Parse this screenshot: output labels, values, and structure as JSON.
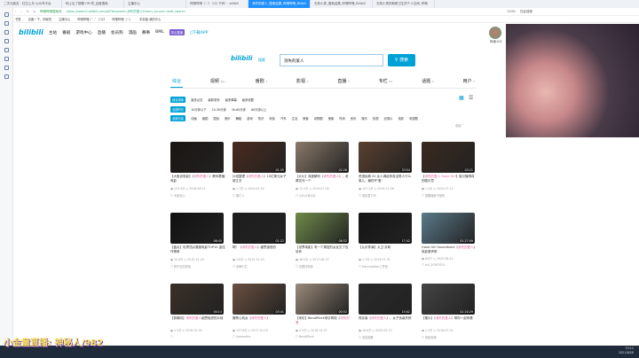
{
  "browser": {
    "tabs": [
      "二次元朋友 · 红白上月 公众号平台",
      "网上出了部跟 OR 吧_百度搜索",
      "主播中心",
      "哔哩哔哩（'-'）つロ 干杯~ -bilibili",
      "消失的爱人_搜索结果_哔哩哔哩_Bilibili",
      "无效小男_搜索结果_哔哩哔哩_Bilibili",
      "无效小男的和鲜卫生的个人空间_哔哩"
    ],
    "url_label": "哔哩哔哩搜索页",
    "url": "https://search.bilibili.com/all?keyword=消失的爱人&from_source=web_search",
    "zoom": "110%",
    "search_engine": "在此搜索",
    "bookmarks": [
      "书签",
      "百度一下，你就知",
      "主播中心",
      "哔哩哔哩 (゜-゜)つロ",
      "哔哩哔哩（'-'）",
      "手机版·我的中心"
    ]
  },
  "header": {
    "nav": [
      "主站",
      "番剧",
      "游戏中心",
      "直播",
      "会员购",
      "漫画",
      "赛事",
      "BML"
    ],
    "tag": "风云直播",
    "download": "下载APP",
    "user": "碎缘102"
  },
  "search": {
    "logo_sub": "搜索",
    "query": "消失的爱人",
    "button": "搜索"
  },
  "type_tabs": [
    {
      "label": "综合",
      "count": ""
    },
    {
      "label": "视频",
      "count": "99+"
    },
    {
      "label": "番剧",
      "count": "1"
    },
    {
      "label": "影视",
      "count": "0"
    },
    {
      "label": "直播",
      "count": "0"
    },
    {
      "label": "专栏",
      "count": "69"
    },
    {
      "label": "话题",
      "count": "0"
    },
    {
      "label": "用户",
      "count": "2"
    }
  ],
  "filters": {
    "order": [
      "综合排序",
      "最多点击",
      "最新发布",
      "最多弹幕",
      "最多收藏"
    ],
    "duration": [
      "全部时长",
      "10分钟以下",
      "10-30分钟",
      "30-60分钟",
      "60分钟以上"
    ],
    "zones": [
      "全部分区",
      "动画",
      "番剧",
      "国创",
      "音乐",
      "舞蹈",
      "游戏",
      "知识",
      "科技",
      "汽车",
      "生活",
      "美食",
      "动物圈",
      "鬼畜",
      "时尚",
      "资讯",
      "娱乐",
      "影视",
      "纪录片",
      "电影",
      "电视剧"
    ],
    "collapse": "收起"
  },
  "videos": [
    {
      "pre": "【大鱼说电影】《",
      "hl": "消失的爱人",
      "post": "》教你看懂电影",
      "views": "123.4万",
      "date": "2018-08-11",
      "up": "大鱼说心",
      "dur": "",
      "bg": "#1a1512"
    },
    {
      "pre": "片段整理《",
      "hl": "消失的爱人",
      "post": "》10亿美元女子被丈夫",
      "views": "1.7万",
      "date": "2020-03-24",
      "up": "撤江人",
      "dur": "01:35",
      "bg": "#4a2a1e"
    },
    {
      "pre": "【片片】深度解析《",
      "hl": "消失的爱人",
      "post": "》，老婆花光一个",
      "views": "72.0万",
      "date": "2019-07-05",
      "up": "小片片说大片",
      "dur": "02:26",
      "bg": "#8a7a6a"
    },
    {
      "pre": "低语经典 02 女人调起来真没男人什么事儿，最终坏'爱'",
      "hl": "",
      "post": "",
      "views": "107.1万",
      "date": "2019-11-06",
      "up": "电影君TOP",
      "dur": "33:54",
      "bg": "#5a4030"
    },
    {
      "pre": "【",
      "hl": "消失的爱人 Gone Girl",
      "post": "】吸引懂得真的图示意",
      "views": "1.4万",
      "date": "2020-07-12",
      "up": "提醒播放不错的",
      "dur": "03:21",
      "bg": "#3a2a20"
    },
    {
      "pre": "【盘点】世界顶尖悬疑电影TOP10 金佳作榜单",
      "hl": "",
      "post": "",
      "views": "30.6万",
      "date": "2019-12-16",
      "up": "看不见的剪色",
      "dur": "06:45",
      "bg": "#111"
    },
    {
      "pre": "啊！《",
      "hl": "消失的爱人",
      "post": "》细思极恐的",
      "views": "4.6万",
      "date": "2015-10-10",
      "up": "冰狮小生",
      "dur": "01:22",
      "bg": "#1e1e1e"
    },
    {
      "pre": "【世界电影】有一个周密的女友忘了告诉你",
      "hl": "",
      "post": "",
      "views": "46.0万",
      "date": "2017-08-27",
      "up": "全国抖电影",
      "dur": "06:52",
      "bg": "#6f8a4a"
    },
    {
      "pre": "【认识导演】大卫·芬奇",
      "hl": "",
      "post": "",
      "views": "1.7万",
      "date": "2019-07-31",
      "up": "MorningStar工作室",
      "dur": "17:42",
      "bg": "#151515"
    },
    {
      "pre": "Gone Girl Soundtrack《",
      "hl": "消失的爱人",
      "post": "》电影原声带",
      "views": "8457",
      "date": "2020-08-22",
      "up": "bili_24367001",
      "dur": "01:27:09",
      "bg": "#5a7a8a"
    },
    {
      "pre": "【剪辑向】",
      "hl": "消失的爱人",
      "post": "细思极恐的片段",
      "views": "1.3万",
      "date": "2018-10-09",
      "up": "",
      "dur": "00:14",
      "bg": "#3a3028"
    },
    {
      "pre": "撒蔡心机女《",
      "hl": "消失的爱人",
      "post": "》",
      "views": "137.6万",
      "date": "2017-10-19",
      "up": "Samantha",
      "dur": "03:41",
      "bg": "#6a5040"
    },
    {
      "pre": "【采访】BenAffleck采访再现《",
      "hl": "消失的爱",
      "post": "",
      "views": "3.5万",
      "date": "2016-12-27",
      "up": "BenAffleck",
      "dur": "00:52",
      "bg": "#9a8a7a"
    },
    {
      "pre": "现实版《",
      "hl": "消失的爱人",
      "post": "》，女子伪装失踪",
      "views": "16.6万",
      "date": "2020-05-13",
      "up": "讲述观察",
      "dur": "15:02",
      "bg": "#2a2a2a"
    },
    {
      "pre": "【推片】《",
      "hl": "消失的爱人",
      "post": "》带你一起来看",
      "views": "1.3万",
      "date": "2018-07-22",
      "up": "电影剪辑",
      "dur": "01:20:29",
      "bg": "#444"
    }
  ],
  "overlay_text": "小金童直播: 神秘人/982",
  "tray": {
    "time": "15:11",
    "date": "2021/6/28"
  }
}
